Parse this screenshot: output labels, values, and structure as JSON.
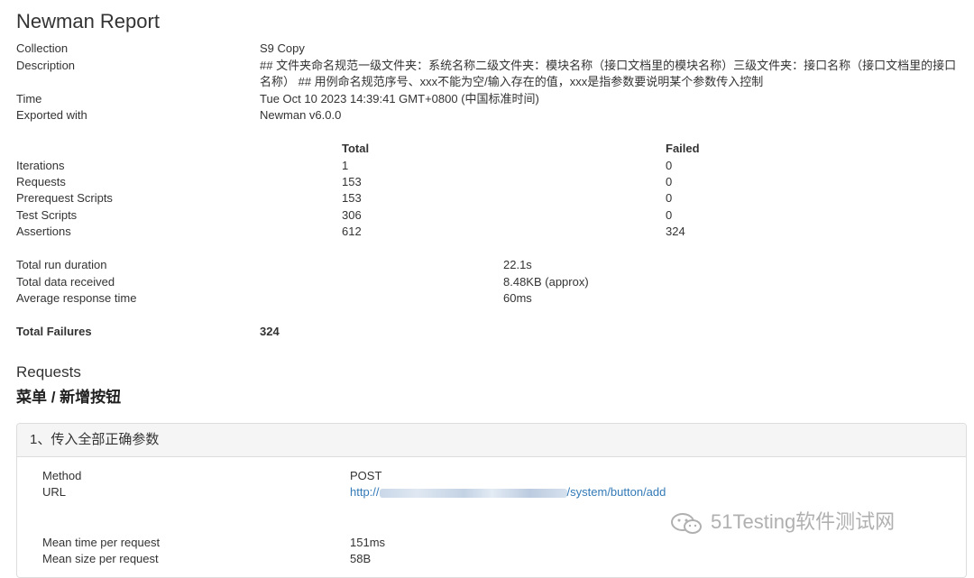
{
  "report": {
    "title": "Newman Report"
  },
  "info": [
    {
      "label": "Collection",
      "value": "S9 Copy"
    },
    {
      "label": "Description",
      "value": "## 文件夹命名规范一级文件夹：系统名称二级文件夹：模块名称（接口文档里的模块名称）三级文件夹：接口名称（接口文档里的接口名称） ## 用例命名规范序号、xxx不能为空/输入存在的值，xxx是指参数要说明某个参数传入控制"
    },
    {
      "label": "Time",
      "value": "Tue Oct 10 2023 14:39:41 GMT+0800 (中国标准时间)"
    },
    {
      "label": "Exported with",
      "value": "Newman v6.0.0"
    }
  ],
  "stats": {
    "headers": {
      "total": "Total",
      "failed": "Failed"
    },
    "rows": [
      {
        "label": "Iterations",
        "total": "1",
        "failed": "0"
      },
      {
        "label": "Requests",
        "total": "153",
        "failed": "0"
      },
      {
        "label": "Prerequest Scripts",
        "total": "153",
        "failed": "0"
      },
      {
        "label": "Test Scripts",
        "total": "306",
        "failed": "0"
      },
      {
        "label": "Assertions",
        "total": "612",
        "failed": "324"
      }
    ]
  },
  "timings": [
    {
      "label": "Total run duration",
      "value": "22.1s"
    },
    {
      "label": "Total data received",
      "value": "8.48KB (approx)"
    },
    {
      "label": "Average response time",
      "value": "60ms"
    }
  ],
  "failures": {
    "label": "Total Failures",
    "value": "324"
  },
  "requests": {
    "heading": "Requests",
    "folder": "菜单 / 新增按钮",
    "panel": {
      "title": "1、传入全部正确参数",
      "method_label": "Method",
      "method_value": "POST",
      "url_label": "URL",
      "url_prefix": "http://",
      "url_suffix": "/system/button/add",
      "mean_time_label": "Mean time per request",
      "mean_time_value": "151ms",
      "mean_size_label": "Mean size per request",
      "mean_size_value": "58B"
    }
  },
  "watermark": {
    "text": "51Testing软件测试网",
    "icon": "wechat-icon"
  }
}
